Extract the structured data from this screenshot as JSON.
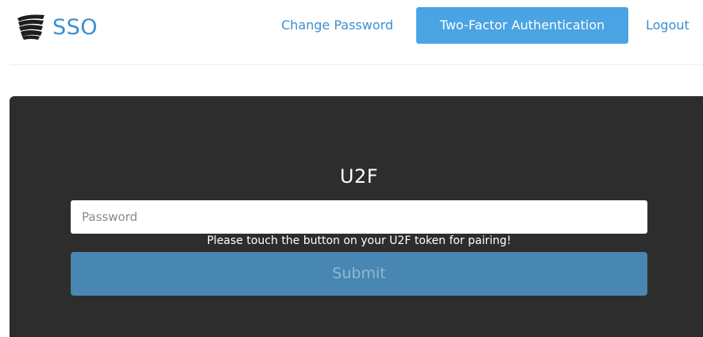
{
  "brand": {
    "name": "SSO",
    "logo_icon": "layered-wave-logo-icon",
    "color": "#3d8ecf"
  },
  "nav": {
    "change_password": "Change Password",
    "two_factor": "Two-Factor Authentication",
    "logout": "Logout",
    "active_item": "Two-Factor Authentication",
    "active_color": "#4aa3e3"
  },
  "panel": {
    "title": "U2F",
    "password_placeholder": "Password",
    "hint": "Please touch the button on your U2F token for pairing!",
    "submit_label": "Submit",
    "background": "#2d2d2d",
    "button_color": "#4787b2"
  }
}
